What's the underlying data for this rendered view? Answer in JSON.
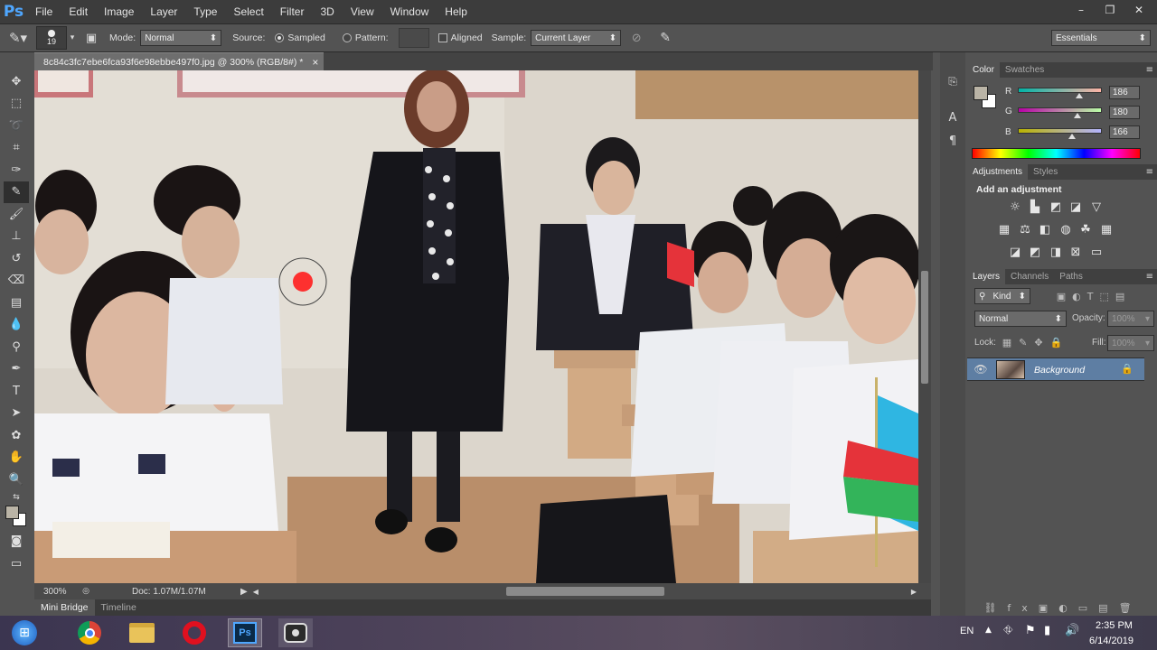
{
  "app": {
    "logo": "Ps"
  },
  "menu": [
    "File",
    "Edit",
    "Image",
    "Layer",
    "Type",
    "Select",
    "Filter",
    "3D",
    "View",
    "Window",
    "Help"
  ],
  "window_buttons": {
    "minimize": "–",
    "restore": "❐",
    "close": "✕"
  },
  "options": {
    "brush_size": "19",
    "mode_label": "Mode:",
    "mode_value": "Normal",
    "source_label": "Source:",
    "sampled_label": "Sampled",
    "pattern_label": "Pattern:",
    "aligned_label": "Aligned",
    "sample_label": "Sample:",
    "sample_value": "Current Layer",
    "workspace": "Essentials"
  },
  "document": {
    "tab_title": "8c84c3fc7ebe6fca93f6e98ebbe497f0.jpg @ 300% (RGB/8#) *",
    "close_glyph": "×"
  },
  "status": {
    "zoom": "300%",
    "doc_info": "Doc: 1.07M/1.07M"
  },
  "bottom_tabs": [
    "Mini Bridge",
    "Timeline"
  ],
  "color_panel": {
    "tabs": [
      "Color",
      "Swatches"
    ],
    "channels": [
      {
        "label": "R",
        "value": "186",
        "level": 0.73
      },
      {
        "label": "G",
        "value": "180",
        "level": 0.71
      },
      {
        "label": "B",
        "value": "166",
        "level": 0.65
      }
    ],
    "foreground": "#bab4a6",
    "background": "#ffffff"
  },
  "adjustments_panel": {
    "tabs": [
      "Adjustments",
      "Styles"
    ],
    "heading": "Add an adjustment"
  },
  "layers_panel": {
    "tabs": [
      "Layers",
      "Channels",
      "Paths"
    ],
    "kind_label": "Kind",
    "blend_mode": "Normal",
    "opacity_label": "Opacity:",
    "opacity_value": "100%",
    "lock_label": "Lock:",
    "fill_label": "Fill:",
    "fill_value": "100%",
    "layers": [
      {
        "name": "Background",
        "visible": true,
        "locked": true
      }
    ]
  },
  "taskbar": {
    "language": "EN",
    "time": "2:35 PM",
    "date": "6/14/2019"
  }
}
